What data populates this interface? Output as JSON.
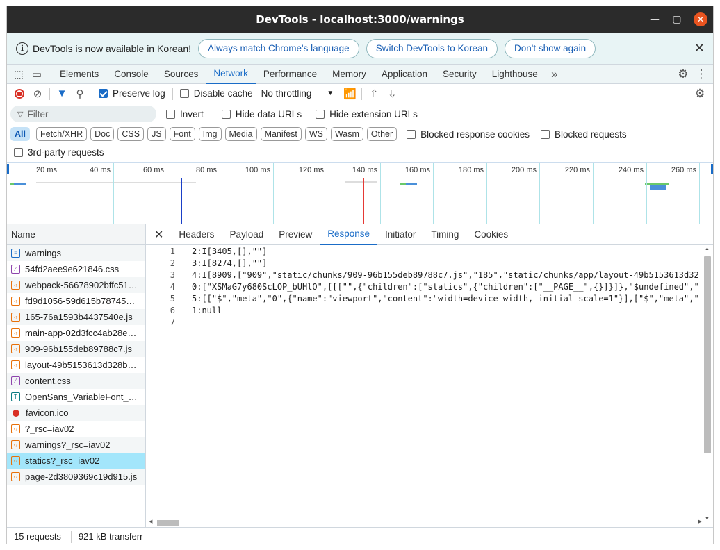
{
  "window": {
    "title": "DevTools - localhost:3000/warnings"
  },
  "infobar": {
    "message": "DevTools is now available in Korean!",
    "btn_match": "Always match Chrome's language",
    "btn_switch": "Switch DevTools to Korean",
    "btn_dismiss": "Don't show again"
  },
  "tabs": [
    "Elements",
    "Console",
    "Sources",
    "Network",
    "Performance",
    "Memory",
    "Application",
    "Security",
    "Lighthouse"
  ],
  "active_tab": "Network",
  "toolbar": {
    "preserve_log": "Preserve log",
    "disable_cache": "Disable cache",
    "throttling": "No throttling"
  },
  "filter": {
    "placeholder": "Filter",
    "invert": "Invert",
    "hide_data": "Hide data URLs",
    "hide_ext": "Hide extension URLs"
  },
  "types": [
    "All",
    "Fetch/XHR",
    "Doc",
    "CSS",
    "JS",
    "Font",
    "Img",
    "Media",
    "Manifest",
    "WS",
    "Wasm",
    "Other"
  ],
  "blocked_cookies": "Blocked response cookies",
  "blocked_requests": "Blocked requests",
  "third_party": "3rd-party requests",
  "overview_ticks": [
    "20 ms",
    "40 ms",
    "60 ms",
    "80 ms",
    "100 ms",
    "120 ms",
    "140 ms",
    "160 ms",
    "180 ms",
    "200 ms",
    "220 ms",
    "240 ms",
    "260 ms"
  ],
  "requests_header": "Name",
  "requests": [
    {
      "name": "warnings",
      "type": "doc"
    },
    {
      "name": "54fd2aee9e621846.css",
      "type": "css"
    },
    {
      "name": "webpack-56678902bffc51…",
      "type": "js"
    },
    {
      "name": "fd9d1056-59d615b78745…",
      "type": "js"
    },
    {
      "name": "165-76a1593b4437540e.js",
      "type": "js"
    },
    {
      "name": "main-app-02d3fcc4ab28e…",
      "type": "js"
    },
    {
      "name": "909-96b155deb89788c7.js",
      "type": "js"
    },
    {
      "name": "layout-49b5153613d328b…",
      "type": "js"
    },
    {
      "name": "content.css",
      "type": "css"
    },
    {
      "name": "OpenSans_VariableFont_…",
      "type": "font"
    },
    {
      "name": "favicon.ico",
      "type": "img"
    },
    {
      "name": "?_rsc=iav02",
      "type": "js"
    },
    {
      "name": "warnings?_rsc=iav02",
      "type": "js"
    },
    {
      "name": "statics?_rsc=iav02",
      "type": "js",
      "selected": true
    },
    {
      "name": "page-2d3809369c19d915.js",
      "type": "js"
    }
  ],
  "detail_tabs": [
    "Headers",
    "Payload",
    "Preview",
    "Response",
    "Initiator",
    "Timing",
    "Cookies"
  ],
  "active_detail_tab": "Response",
  "response_lines": [
    "2:I[3405,[],\"\"]",
    "3:I[8274,[],\"\"]",
    "4:I[8909,[\"909\",\"static/chunks/909-96b155deb89788c7.js\",\"185\",\"static/chunks/app/layout-49b5153613d32",
    "0:[\"XSMaG7y680ScLOP_bUHlO\",[[[\"\",{\"children\":[\"statics\",{\"children\":[\"__PAGE__\",{}]}]},\"$undefined\",\"",
    "5:[[\"$\",\"meta\",\"0\",{\"name\":\"viewport\",\"content\":\"width=device-width, initial-scale=1\"}],[\"$\",\"meta\",\"",
    "1:null",
    ""
  ],
  "status": {
    "requests": "15 requests",
    "transferred": "921 kB transferr"
  }
}
